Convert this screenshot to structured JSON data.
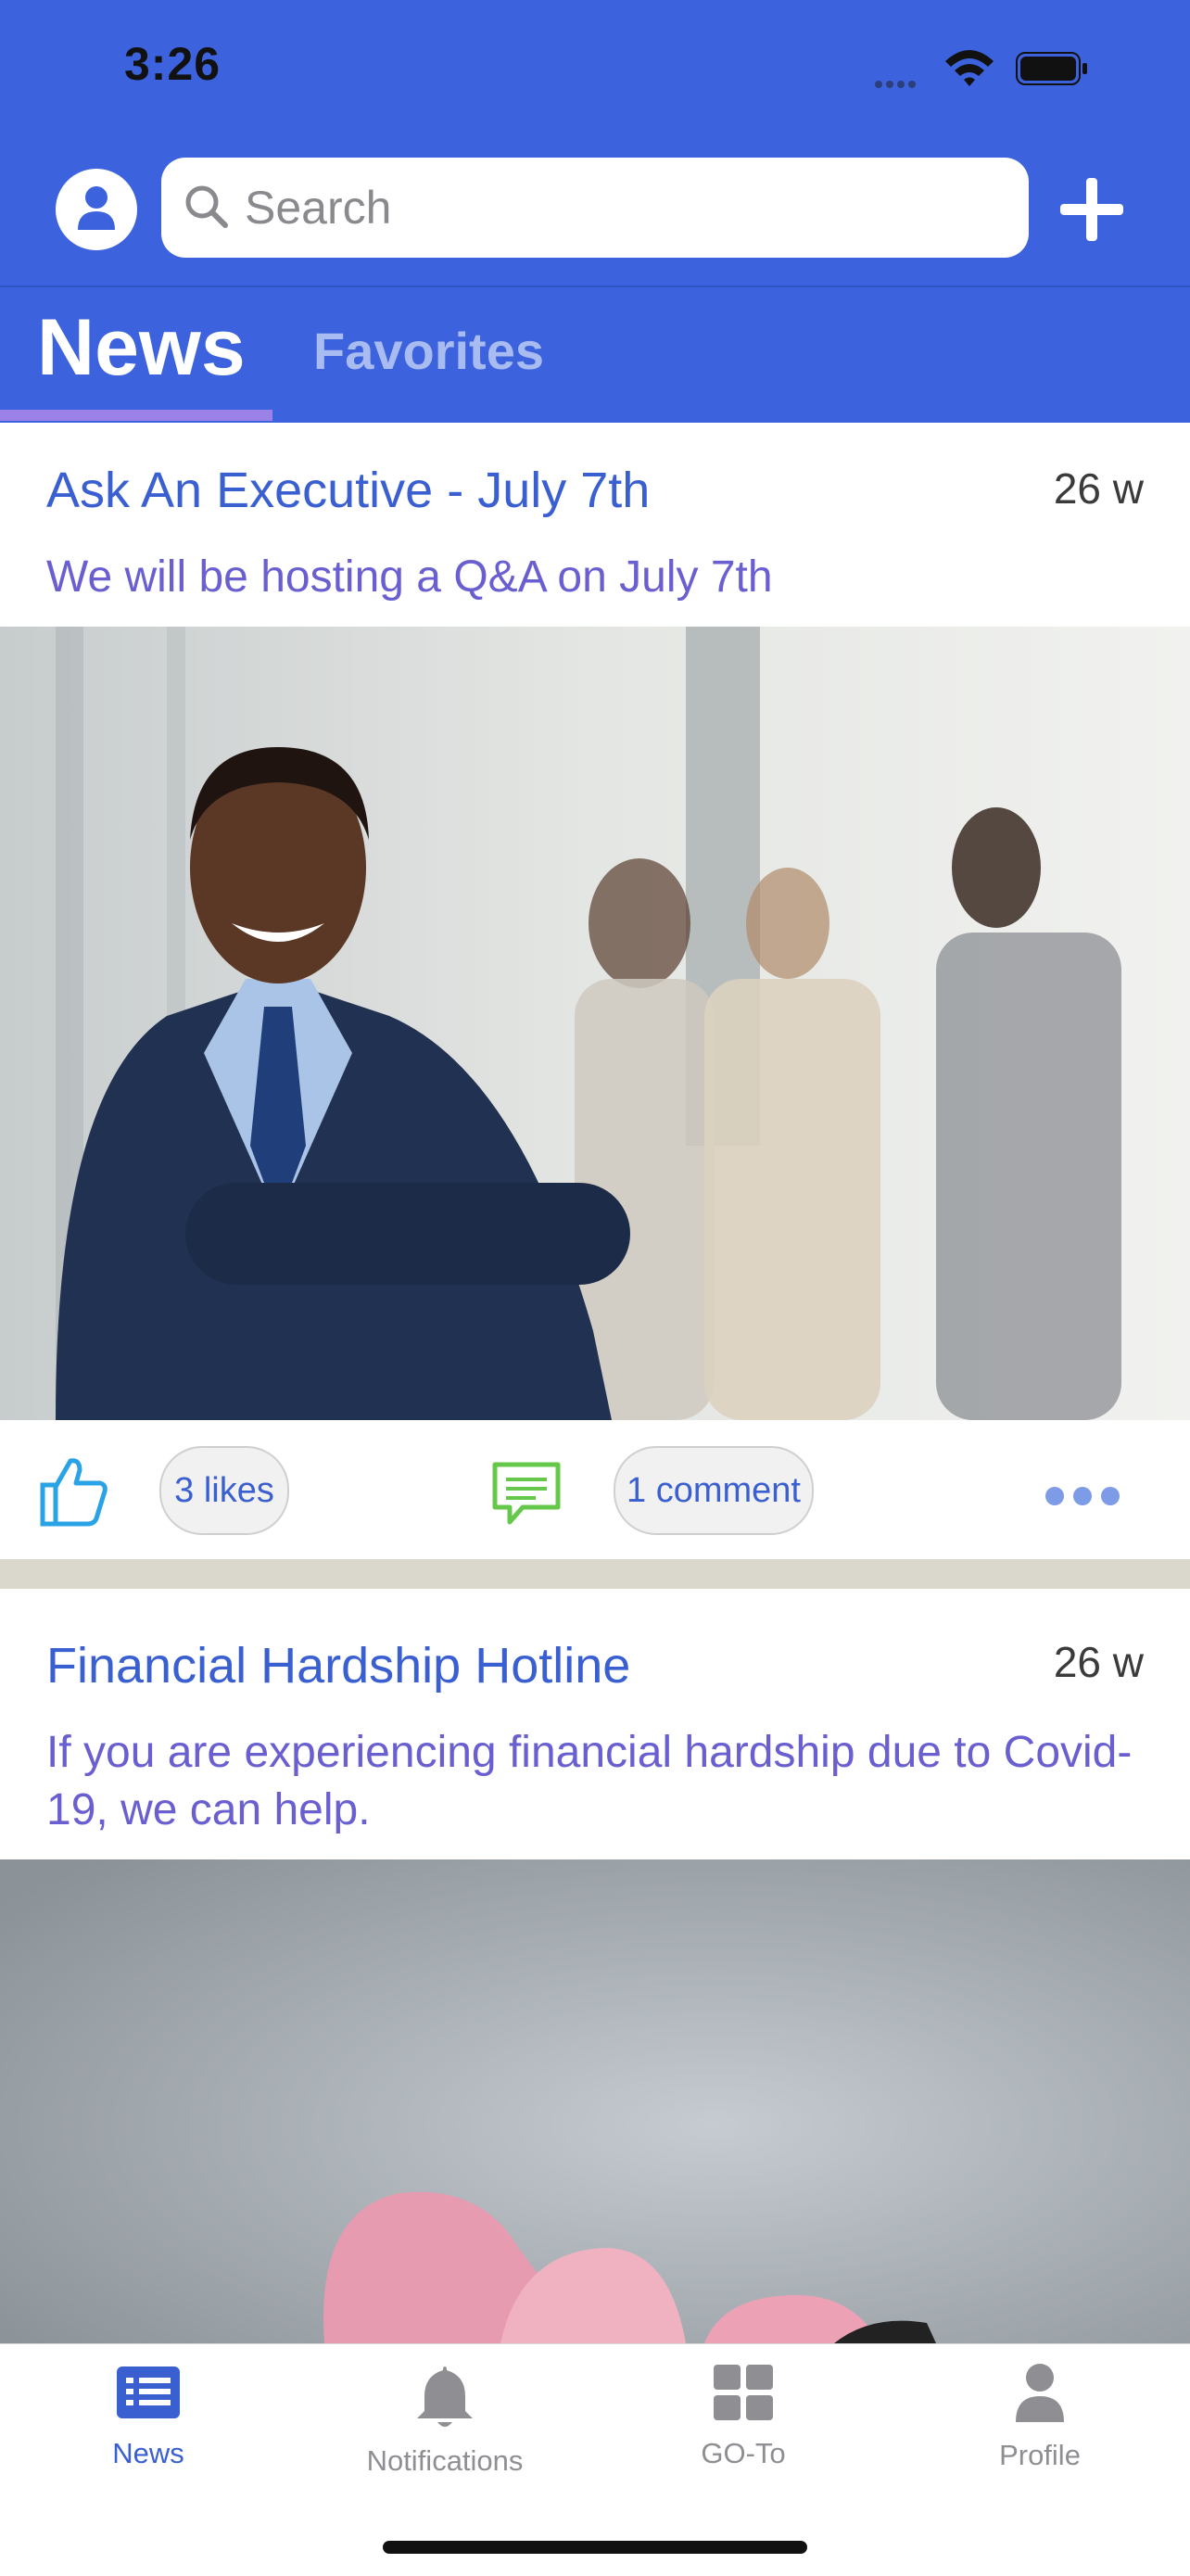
{
  "status": {
    "time": "3:26"
  },
  "header": {
    "search_placeholder": "Search",
    "tabs": [
      {
        "label": "News",
        "active": true
      },
      {
        "label": "Favorites",
        "active": false
      }
    ]
  },
  "posts": [
    {
      "title": "Ask An Executive - July 7th",
      "subtitle": "We will be hosting a Q&A on July 7th",
      "age": "26 w",
      "likes": "3 likes",
      "comments": "1 comment"
    },
    {
      "title": "Financial Hardship Hotline",
      "subtitle": "If you are experiencing financial hardship due to Covid-19, we can help.",
      "age": "26 w"
    }
  ],
  "bottom_nav": [
    {
      "label": "News",
      "icon": "news-icon",
      "active": true
    },
    {
      "label": "Notifications",
      "icon": "bell-icon",
      "active": false
    },
    {
      "label": "GO-To",
      "icon": "grid-icon",
      "active": false
    },
    {
      "label": "Profile",
      "icon": "person-icon",
      "active": false
    }
  ],
  "colors": {
    "header": "#3c63dd",
    "accent": "#3a5fd1",
    "subtitle": "#6a5fd0",
    "tab_underline": "#9b82e6"
  }
}
